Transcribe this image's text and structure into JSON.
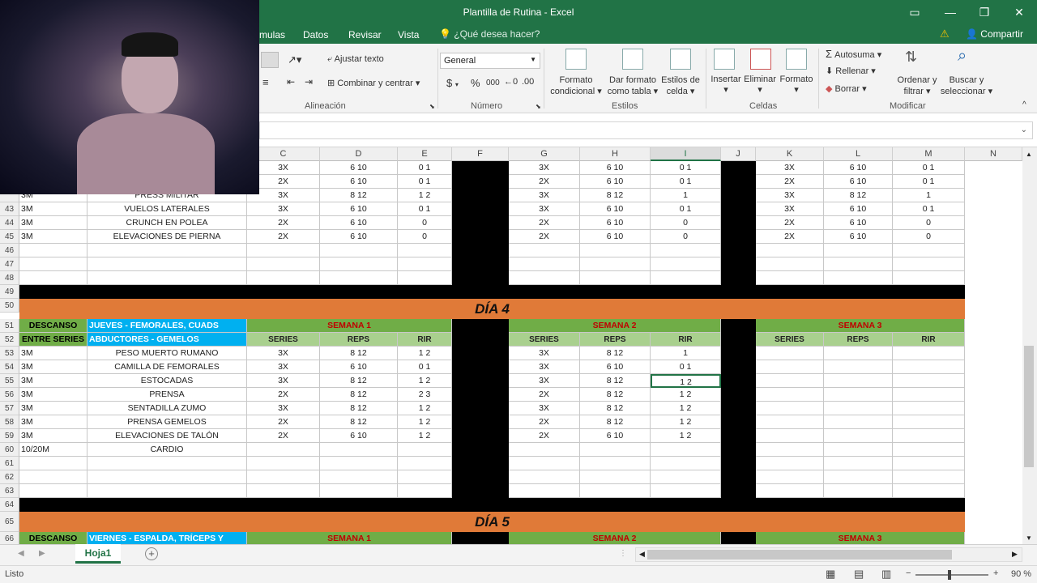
{
  "window": {
    "title": "Plantilla de Rutina - Excel"
  },
  "tabs": [
    "mulas",
    "Datos",
    "Revisar",
    "Vista"
  ],
  "tell_me": "¿Qué desea hacer?",
  "share": "Compartir",
  "ribbon": {
    "wrap_text": "Ajustar texto",
    "merge_center": "Combinar y centrar",
    "number_format": "General",
    "currency": "$",
    "percent": "%",
    "thousands": "000",
    "cond_format": [
      "Formato",
      "condicional"
    ],
    "format_table": [
      "Dar formato",
      "como tabla"
    ],
    "cell_styles": [
      "Estilos de",
      "celda"
    ],
    "insert": "Insertar",
    "delete": "Eliminar",
    "format": "Formato",
    "autosum": "Autosuma",
    "fill": "Rellenar",
    "clear": "Borrar",
    "sort_filter": [
      "Ordenar y",
      "filtrar"
    ],
    "find_select": [
      "Buscar y",
      "seleccionar"
    ],
    "groups": [
      "Alineación",
      "Número",
      "Estilos",
      "Celdas",
      "Modificar"
    ]
  },
  "columns": [
    "C",
    "D",
    "E",
    "F",
    "G",
    "H",
    "I",
    "J",
    "K",
    "L",
    "M",
    "N"
  ],
  "rows_top": [
    {
      "n": "",
      "a": "",
      "b": "",
      "c": "3X",
      "d": "6 10",
      "e": "0 1",
      "g": "3X",
      "h": "6 10",
      "i": "0 1",
      "k": "3X",
      "l": "6 10",
      "m": "0 1"
    },
    {
      "n": "",
      "a": "",
      "b": "",
      "c": "2X",
      "d": "6 10",
      "e": "0 1",
      "g": "2X",
      "h": "6 10",
      "i": "0 1",
      "k": "2X",
      "l": "6 10",
      "m": "0 1"
    },
    {
      "n": "",
      "a": "3M",
      "b": "PRESS MILITAR",
      "c": "3X",
      "d": "8 12",
      "e": "1 2",
      "g": "3X",
      "h": "8 12",
      "i": "1",
      "k": "3X",
      "l": "8 12",
      "m": "1"
    },
    {
      "n": "43",
      "a": "3M",
      "b": "VUELOS LATERALES",
      "c": "3X",
      "d": "6 10",
      "e": "0 1",
      "g": "3X",
      "h": "6 10",
      "i": "0 1",
      "k": "3X",
      "l": "6 10",
      "m": "0 1"
    },
    {
      "n": "44",
      "a": "3M",
      "b": "CRUNCH EN POLEA",
      "c": "2X",
      "d": "6 10",
      "e": "0",
      "g": "2X",
      "h": "6 10",
      "i": "0",
      "k": "2X",
      "l": "6 10",
      "m": "0"
    },
    {
      "n": "45",
      "a": "3M",
      "b": "ELEVACIONES DE PIERNA",
      "c": "2X",
      "d": "6 10",
      "e": "0",
      "g": "2X",
      "h": "6 10",
      "i": "0",
      "k": "2X",
      "l": "6 10",
      "m": "0"
    }
  ],
  "empty_rows_a": [
    "46",
    "47",
    "48"
  ],
  "row49": "49",
  "row50": {
    "n": "50",
    "label": "DÍA 4"
  },
  "row51": {
    "n": "51",
    "a": "DESCANSO",
    "b": "JUEVES - FEMORALES, CUADS",
    "w1": "SEMANA 1",
    "w2": "SEMANA 2",
    "w3": "SEMANA 3"
  },
  "row52": {
    "n": "52",
    "a": "ENTRE SERIES",
    "b": "ABDUCTORES - GEMELOS",
    "series": "SERIES",
    "reps": "REPS",
    "rir": "RIR"
  },
  "rows_day4": [
    {
      "n": "53",
      "a": "3M",
      "b": "PESO MUERTO RUMANO",
      "c": "3X",
      "d": "8 12",
      "e": "1 2",
      "g": "3X",
      "h": "8 12",
      "i": "1"
    },
    {
      "n": "54",
      "a": "3M",
      "b": "CAMILLA DE FEMORALES",
      "c": "3X",
      "d": "6 10",
      "e": "0 1",
      "g": "3X",
      "h": "6 10",
      "i": "0 1"
    },
    {
      "n": "55",
      "a": "3M",
      "b": "ESTOCADAS",
      "c": "3X",
      "d": "8 12",
      "e": "1 2",
      "g": "3X",
      "h": "8 12",
      "i": "1 2"
    },
    {
      "n": "56",
      "a": "3M",
      "b": "PRENSA",
      "c": "2X",
      "d": "8 12",
      "e": "2 3",
      "g": "2X",
      "h": "8 12",
      "i": "1 2"
    },
    {
      "n": "57",
      "a": "3M",
      "b": "SENTADILLA ZUMO",
      "c": "3X",
      "d": "8 12",
      "e": "1 2",
      "g": "3X",
      "h": "8 12",
      "i": "1 2"
    },
    {
      "n": "58",
      "a": "3M",
      "b": "PRENSA GEMELOS",
      "c": "2X",
      "d": "8 12",
      "e": "1 2",
      "g": "2X",
      "h": "8 12",
      "i": "1 2"
    },
    {
      "n": "59",
      "a": "3M",
      "b": "ELEVACIONES DE TALÓN",
      "c": "2X",
      "d": "6 10",
      "e": "1 2",
      "g": "2X",
      "h": "6 10",
      "i": "1 2"
    },
    {
      "n": "60",
      "a": "10/20M",
      "b": "CARDIO",
      "c": "",
      "d": "",
      "e": "",
      "g": "",
      "h": "",
      "i": ""
    }
  ],
  "empty_rows_b": [
    "61",
    "62",
    "63"
  ],
  "row64": "64",
  "row65": {
    "n": "65",
    "label": "DÍA 5"
  },
  "row66": {
    "n": "66",
    "a": "DESCANSO",
    "b": "VIERNES - ESPALDA, TRÍCEPS Y",
    "w1": "SEMANA 1",
    "w2": "SEMANA 2",
    "w3": "SEMANA 3"
  },
  "sheet_tab": "Hoja1",
  "status": {
    "ready": "Listo",
    "zoom": "90 %"
  },
  "colors": {
    "excel_green": "#217346",
    "orange": "#e07a38",
    "cyan": "#00b0f0"
  }
}
